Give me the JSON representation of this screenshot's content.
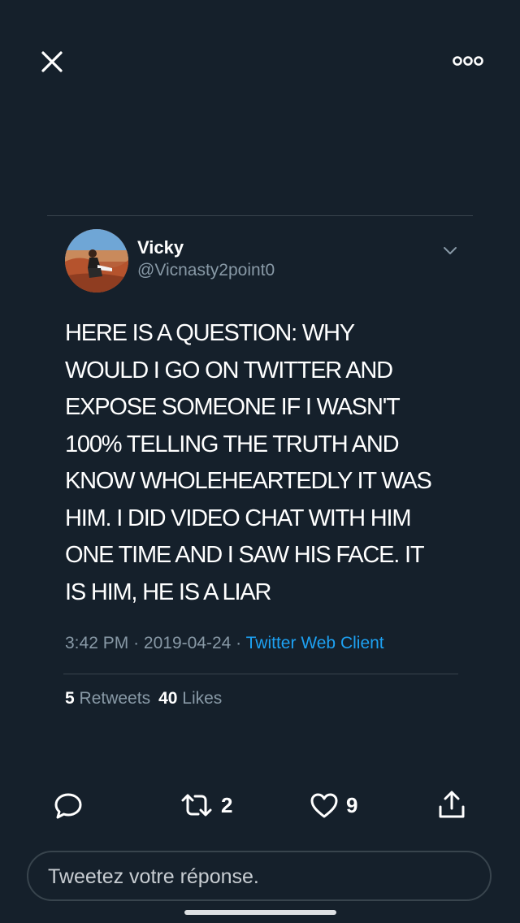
{
  "nav": {
    "close_icon": "close-icon",
    "more_icon": "more-dots-icon"
  },
  "tweet": {
    "display_name": "Vicky",
    "handle": "@Vicnasty2point0",
    "text": "HERE IS A QUESTION: WHY\nWOULD I GO ON TWITTER AND\nEXPOSE SOMEONE IF I WASN'T\n100% TELLING THE TRUTH AND\nKNOW WHOLEHEARTEDLY IT WAS\nHIM. I DID VIDEO CHAT WITH HIM\nONE TIME AND I SAW HIS FACE. IT\nIS HIM, HE IS A LIAR",
    "time": "3:42 PM",
    "separator": "·",
    "date": "2019-04-24",
    "source": "Twitter Web Client"
  },
  "stats": {
    "retweets_count": "5",
    "retweets_label": "Retweets",
    "likes_count": "40",
    "likes_label": "Likes"
  },
  "actions": {
    "reply_icon": "reply-icon",
    "retweet_icon": "retweet-icon",
    "retweet_count": "2",
    "like_icon": "heart-icon",
    "like_count": "9",
    "share_icon": "share-icon"
  },
  "reply": {
    "placeholder": "Tweetez votre réponse."
  },
  "colors": {
    "background": "#15202b",
    "divider": "#38444d",
    "secondary_text": "#8899a6",
    "link": "#1da1f2"
  }
}
